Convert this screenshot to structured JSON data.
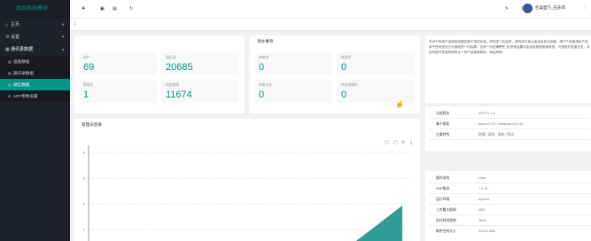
{
  "app": {
    "logo": "后台系统模块"
  },
  "sidebar": {
    "items": [
      {
        "label": "主页",
        "icon": "home-icon"
      },
      {
        "label": "设置",
        "icon": "gear-icon"
      },
      {
        "label": "通讯录数据",
        "icon": "app-icon"
      }
    ],
    "subitems": [
      {
        "label": "设备数据",
        "icon": "list-icon"
      },
      {
        "label": "通讯录数据",
        "icon": "list-icon"
      },
      {
        "label": "短信数据",
        "icon": "list-icon"
      },
      {
        "label": "APP参数设置",
        "icon": "gear-icon"
      }
    ]
  },
  "topbar": {
    "icons": [
      "add-icon",
      "save-icon",
      "trash-icon",
      "refresh-icon"
    ],
    "user": "包桌面乃_石乐风"
  },
  "stats_card": {
    "items": [
      {
        "label": "用户",
        "value": "69"
      },
      {
        "label": "通讯录",
        "value": "20685"
      },
      {
        "label": "管理员",
        "value": "1"
      },
      {
        "label": "短信数据",
        "value": "11674"
      }
    ]
  },
  "todo_card": {
    "title": "待办事项",
    "items": [
      {
        "label": "待审核",
        "value": "0"
      },
      {
        "label": "待发货",
        "value": "0"
      },
      {
        "label": "待审文件",
        "value": "0"
      },
      {
        "label": "待处理邮件",
        "value": "0"
      }
    ]
  },
  "intro_text": "本APP系统产品使用范围仅限于测试实验，研究学习为目的，请勿用于商业途径及非法运营，用户产品使用本产品用于任何违法行为造成的一切后果，否则一切法律责任 及 所有后果均由该系统使用者承担，与系统开发者无关，并且系统开发者有权停止一切产品使用服务，特此声明。",
  "version_card": {
    "rows": [
      {
        "key": "当前版本",
        "value": "APPV1.1.3"
      },
      {
        "key": "基于框架",
        "value": "layui-v2.2.5 / thinkphp-v5.0.24"
      },
      {
        "key": "主要特色",
        "value": "便捷 / 高效 / 清爽 / 简洁"
      }
    ]
  },
  "server_card": {
    "rows": [
      {
        "key": "操作系统",
        "value": "Linux"
      },
      {
        "key": "PHP版本",
        "value": "7.0.33"
      },
      {
        "key": "运行环境",
        "value": "apache"
      },
      {
        "key": "上传最大限制",
        "value": "30M"
      },
      {
        "key": "执行时间限制",
        "value": "300S"
      },
      {
        "key": "剩余空间大小",
        "value": "34374.20M"
      }
    ]
  },
  "chart_data": {
    "type": "area",
    "title": "管理员登录",
    "y_ticks": [
      "4",
      "3",
      "2",
      "1"
    ],
    "ylim": [
      0,
      4
    ],
    "series": [
      {
        "color": "#2f9e96"
      }
    ]
  },
  "colors": {
    "accent": "#009688",
    "sidebar": "#20222a"
  }
}
